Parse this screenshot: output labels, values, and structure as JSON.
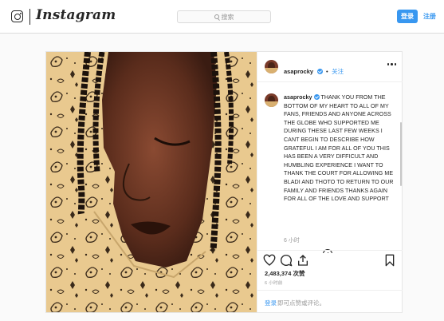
{
  "nav": {
    "wordmark": "Instagram",
    "search_placeholder": "搜索",
    "login_label": "登录",
    "signup_label": "注册"
  },
  "post": {
    "username": "asaprocky",
    "follow_label": "关注",
    "caption": "THANK YOU FROM THE BOTTOM OF MY HEART TO ALL OF MY FANS, FRIENDS AND ANYONE ACROSS THE GLOBE WHO SUPPORTED ME DURING THESE LAST FEW WEEKS I CANT BEGIN TO DESCRIBE HOW GRATEFUL I AM FOR ALL OF YOU THIS HAS BEEN A VERY DIFFICULT AND HUMBLING EXPERIENCE I WANT TO THANK THE COURT FOR ALLOWING ME BLADI AND THOTO TO RETURN TO OUR FAMILY AND FRIENDS THANKS AGAIN FOR ALL OF THE LOVE AND SUPPORT",
    "comment_time": "6 小时",
    "likes": "2,483,374 次赞",
    "posted_time": "6 小时前",
    "login_link": "登录",
    "login_prompt": "即可点赞或评论。"
  },
  "colors": {
    "accent": "#3897f0",
    "bandana": "#e7c78c",
    "text": "#262626",
    "muted": "#999999"
  },
  "icons": [
    "instagram-glyph-icon",
    "search-icon",
    "verified-badge-icon",
    "more-options-icon",
    "add-comment-icon",
    "heart-icon",
    "comment-icon",
    "share-icon",
    "bookmark-icon"
  ]
}
